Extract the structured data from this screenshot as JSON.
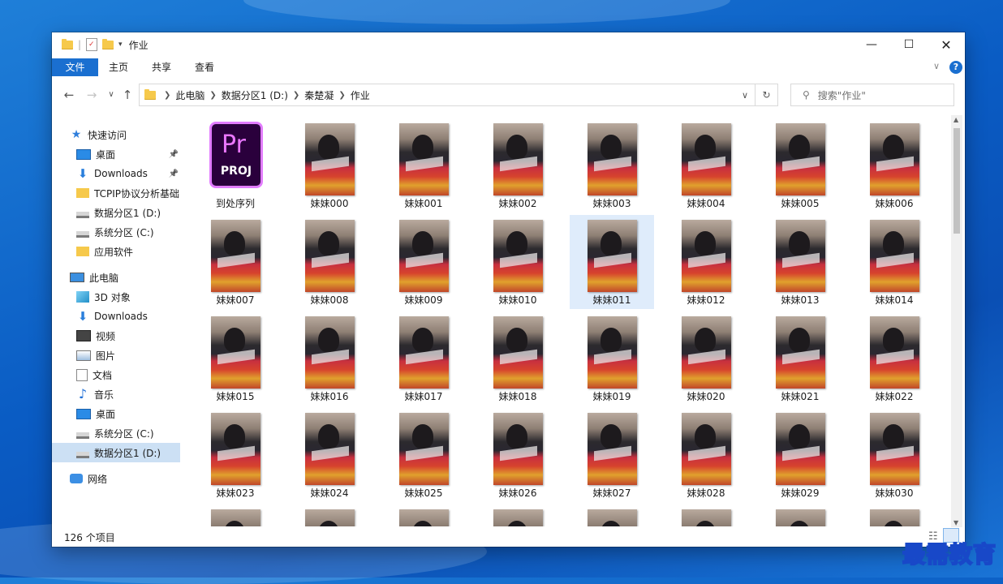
{
  "window": {
    "title": "作业"
  },
  "ribbon": {
    "tabs": [
      "文件",
      "主页",
      "共享",
      "查看"
    ]
  },
  "address": {
    "crumbs": [
      "此电脑",
      "数据分区1 (D:)",
      "秦楚凝",
      "作业"
    ]
  },
  "search": {
    "placeholder": "搜索\"作业\""
  },
  "nav": [
    {
      "label": "快速访问",
      "icon": "star-icon"
    },
    {
      "label": "桌面",
      "icon": "desktop-icon",
      "pinned": true
    },
    {
      "label": "Downloads",
      "icon": "download-icon",
      "pinned": true
    },
    {
      "label": "TCPIP协议分析基础",
      "icon": "folder-icon"
    },
    {
      "label": "数据分区1 (D:)",
      "icon": "drive-icon"
    },
    {
      "label": "系统分区 (C:)",
      "icon": "drive-icon"
    },
    {
      "label": "应用软件",
      "icon": "folder-icon"
    },
    {
      "label": "此电脑",
      "icon": "computer-icon"
    },
    {
      "label": "3D 对象",
      "icon": "cube-icon"
    },
    {
      "label": "Downloads",
      "icon": "download-icon"
    },
    {
      "label": "视频",
      "icon": "video-icon"
    },
    {
      "label": "图片",
      "icon": "picture-icon"
    },
    {
      "label": "文档",
      "icon": "document-icon"
    },
    {
      "label": "音乐",
      "icon": "music-icon"
    },
    {
      "label": "桌面",
      "icon": "desktop-icon"
    },
    {
      "label": "系统分区 (C:)",
      "icon": "drive-icon"
    },
    {
      "label": "数据分区1 (D:)",
      "icon": "drive-icon",
      "selected": true
    },
    {
      "label": "网络",
      "icon": "network-icon"
    }
  ],
  "files": [
    "到处序列",
    "妹妹000",
    "妹妹001",
    "妹妹002",
    "妹妹003",
    "妹妹004",
    "妹妹005",
    "妹妹006",
    "妹妹007",
    "妹妹008",
    "妹妹009",
    "妹妹010",
    "妹妹011",
    "妹妹012",
    "妹妹013",
    "妹妹014",
    "妹妹015",
    "妹妹016",
    "妹妹017",
    "妹妹018",
    "妹妹019",
    "妹妹020",
    "妹妹021",
    "妹妹022",
    "妹妹023",
    "妹妹024",
    "妹妹025",
    "妹妹026",
    "妹妹027",
    "妹妹028",
    "妹妹029",
    "妹妹030"
  ],
  "selected_file": "妹妹011",
  "project_icon": {
    "top": "Pr",
    "bottom": "PROJ"
  },
  "status": {
    "count": "126 个项目"
  },
  "watermark": "最需教育",
  "colors": {
    "accent": "#1a6fd0",
    "selection": "#cce0f4",
    "folder": "#f6c94b",
    "premiere": "#e27cff"
  }
}
